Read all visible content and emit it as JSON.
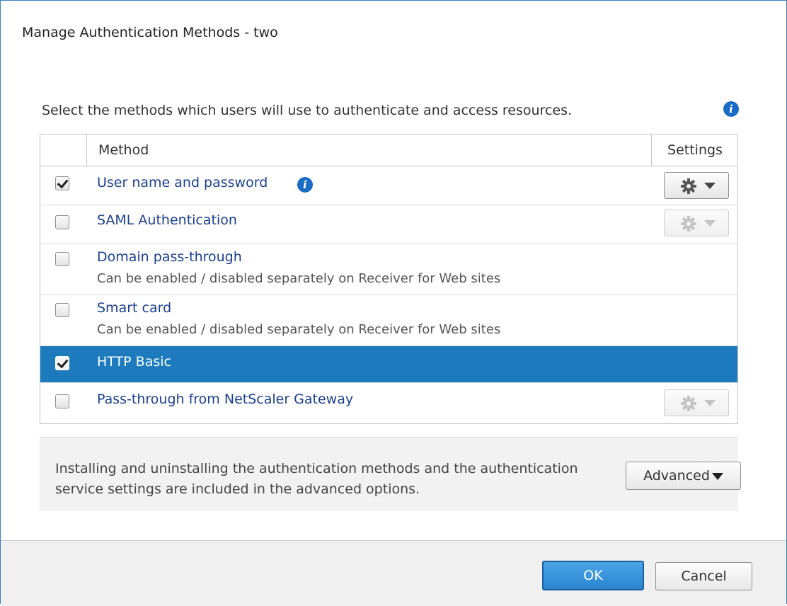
{
  "window": {
    "title": "Manage Authentication Methods - two"
  },
  "intro": {
    "text": "Select the methods which users will use to authenticate and access resources.",
    "info_icon": "info-icon"
  },
  "grid": {
    "columns": {
      "method": "Method",
      "settings": "Settings"
    },
    "rows": [
      {
        "label": "User name and password",
        "description": "",
        "checked": true,
        "selected": false,
        "settings": "enabled",
        "info_icon": true
      },
      {
        "label": "SAML Authentication",
        "description": "",
        "checked": false,
        "selected": false,
        "settings": "disabled",
        "info_icon": false
      },
      {
        "label": "Domain pass-through",
        "description": "Can be enabled / disabled separately on Receiver for Web sites",
        "checked": false,
        "selected": false,
        "settings": "none",
        "info_icon": false
      },
      {
        "label": "Smart card",
        "description": "Can be enabled / disabled separately on Receiver for Web sites",
        "checked": false,
        "selected": false,
        "settings": "none",
        "info_icon": false
      },
      {
        "label": "HTTP Basic",
        "description": "",
        "checked": true,
        "selected": true,
        "settings": "none",
        "info_icon": false
      },
      {
        "label": "Pass-through from NetScaler Gateway",
        "description": "",
        "checked": false,
        "selected": false,
        "settings": "disabled",
        "info_icon": false
      }
    ]
  },
  "advanced": {
    "text": "Installing and uninstalling the authentication methods and the authentication service settings are included in the advanced options.",
    "button_label": "Advanced"
  },
  "buttons": {
    "ok": "OK",
    "cancel": "Cancel"
  },
  "colors": {
    "accent": "#1d7bbd",
    "link": "#1b3f8f",
    "info": "#1a6cc7"
  }
}
